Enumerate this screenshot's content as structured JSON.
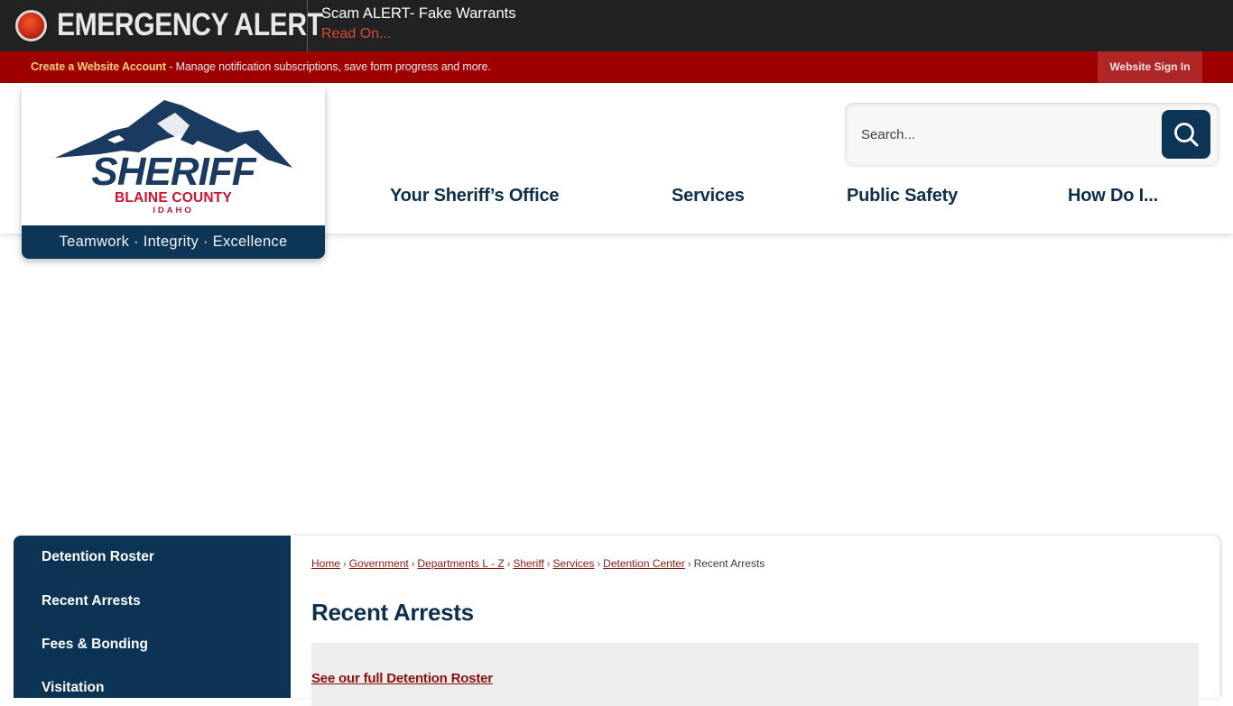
{
  "alert": {
    "icon": "red-alert-light-icon",
    "title": "EMERGENCY ALERT",
    "message": "Scam ALERT- Fake Warrants",
    "read_on": "Read On..."
  },
  "account_bar": {
    "create_link": "Create a Website Account",
    "description": " - Manage notification subscriptions, save form progress and more.",
    "sign_in": "Website Sign In"
  },
  "logo": {
    "title": "SHERIFF",
    "county": "BLAINE COUNTY",
    "state": "IDAHO",
    "tagline": "Teamwork · Integrity · Excellence"
  },
  "search": {
    "placeholder": "Search...",
    "icon": "search-icon"
  },
  "nav": {
    "items": [
      {
        "label": "Your Sheriff’s Office"
      },
      {
        "label": "Services"
      },
      {
        "label": "Public Safety"
      },
      {
        "label": "How Do I..."
      }
    ]
  },
  "sidebar": {
    "items": [
      {
        "label": "Detention Roster"
      },
      {
        "label": "Recent Arrests"
      },
      {
        "label": "Fees & Bonding"
      },
      {
        "label": "Visitation"
      }
    ]
  },
  "breadcrumb": {
    "items": [
      {
        "label": "Home"
      },
      {
        "label": "Government"
      },
      {
        "label": "Departments L - Z"
      },
      {
        "label": "Sheriff"
      },
      {
        "label": "Services"
      },
      {
        "label": "Detention Center"
      }
    ],
    "current": "Recent Arrests",
    "separator": "›"
  },
  "main": {
    "title": "Recent Arrests",
    "roster_link": "See our full Detention Roster"
  },
  "colors": {
    "alert_bg": "#222223",
    "account_bar": "#9e0000",
    "brand_navy": "#0d3556",
    "brand_red": "#c8102e",
    "link_red": "#8c1a16"
  }
}
